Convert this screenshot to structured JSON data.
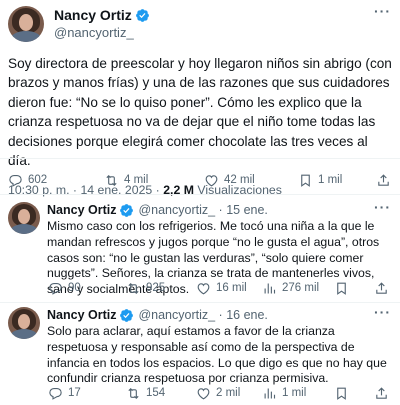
{
  "main": {
    "name": "Nancy Ortiz",
    "handle": "@nancyortiz_",
    "text": "Soy directora de preescolar y hoy llegaron niños sin abrigo (con brazos y manos frías) y una de las razones que sus cuidadores dieron fue: “No se lo quiso poner”. Cómo les explico que la crianza respetuosa no va de dejar que el niño tome todas las decisiones porque elegirá comer chocolate las tres veces al día.",
    "time": "10:30 p. m. · 14 ene. 2025 · ",
    "views_count": "2,2 M",
    "views_label": " Visualizaciones",
    "replies": "602",
    "retweets": "4 mil",
    "likes": "42 mil",
    "bookmarks": "1 mil"
  },
  "replies": [
    {
      "name": "Nancy Ortiz",
      "handle": "@nancyortiz_ · 15 ene.",
      "text": "Mismo caso con los refrigerios. Me tocó una niña a la que le mandan refrescos y jugos porque “no le gusta el agua”, otros casos son: “no le gustan las verduras”, “solo quiere comer nuggets”. Señores, la crianza se trata de mantenerles vivos, sano y socialmente aptos.",
      "replies": "90",
      "retweets": "925",
      "likes": "16 mil",
      "views": "276 mil"
    },
    {
      "name": "Nancy Ortiz",
      "handle": "@nancyortiz_ · 16 ene.",
      "text": "Solo para aclarar, aquí estamos a favor de la crianza respetuosa y responsable así como de la perspectiva de infancia en todos los espacios. Lo que digo es que no hay que confundir crianza respetuosa por crianza permisiva.",
      "replies": "17",
      "retweets": "154",
      "likes": "2 mil",
      "views": "1 mil"
    }
  ],
  "colors": {
    "verified": "#1d9bf0",
    "text": "#0f1419",
    "secondary": "#536471"
  },
  "icons": [
    "verified-badge-icon",
    "more-icon",
    "reply-icon",
    "retweet-icon",
    "like-icon",
    "bookmark-icon",
    "views-icon",
    "share-icon"
  ]
}
